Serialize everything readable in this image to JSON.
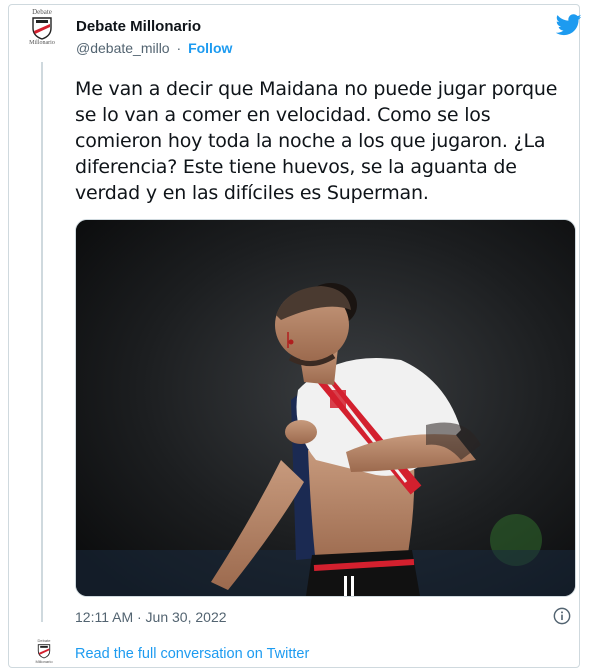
{
  "account": {
    "avatar_top_text": "Debate",
    "avatar_bottom_text": "Millonario",
    "display_name": "Debate Millonario",
    "handle": "@debate_millo",
    "separator": "·",
    "follow_label": "Follow"
  },
  "tweet": {
    "line_1": "Me van a decir que Maidana no puede jugar porque",
    "line_2": "se lo van a comer en velocidad. Como se los",
    "line_3": "comieron hoy toda la noche a los que jugaron. ¿La",
    "line_4": "diferencia? Este tiene huevos, se la aguanta de",
    "line_5": "verdad y en las difíciles es Superman.",
    "timestamp": "12:11 AM · Jun 30, 2022"
  },
  "footer": {
    "read_more_label": "Read the full conversation on Twitter"
  },
  "icons": {
    "brand": "twitter-bird-icon",
    "info": "info-icon",
    "crest": "club-crest-icon"
  },
  "colors": {
    "accent": "#1d9bf0",
    "text": "#0f1419",
    "secondary": "#536471",
    "border": "#cfd9de",
    "jersey_stripe": "#d3202e"
  }
}
